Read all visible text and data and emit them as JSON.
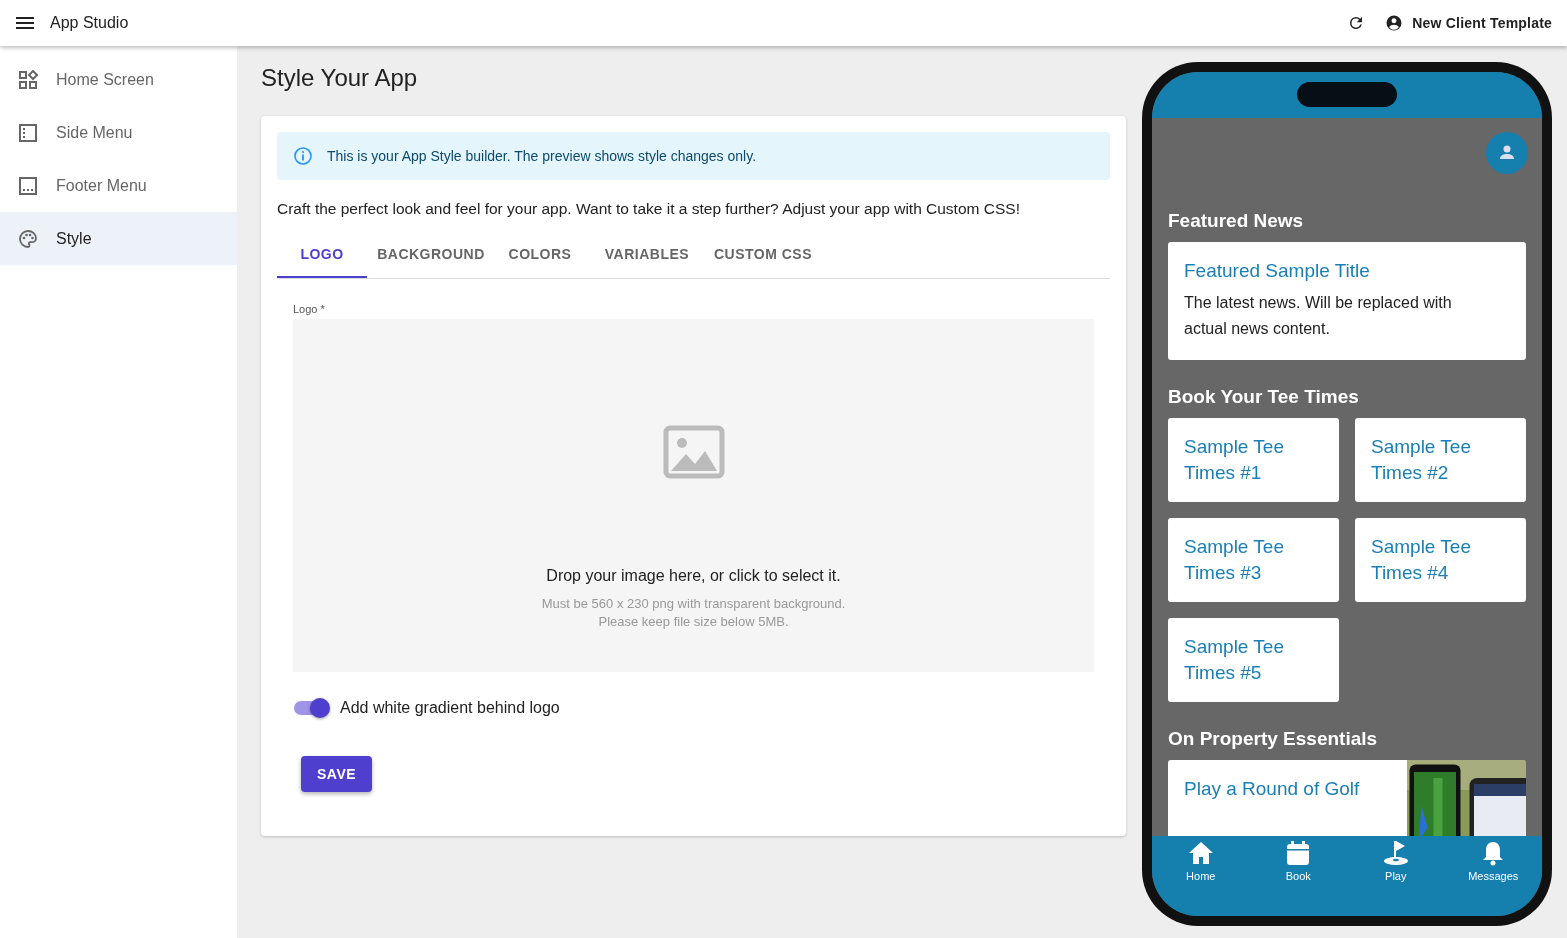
{
  "app_bar": {
    "title": "App Studio",
    "account": "New Client Template"
  },
  "sidebar": {
    "items": [
      {
        "label": "Home Screen",
        "kind": "home",
        "selected": false
      },
      {
        "label": "Side Menu",
        "kind": "side",
        "selected": false
      },
      {
        "label": "Footer Menu",
        "kind": "footer",
        "selected": false
      },
      {
        "label": "Style",
        "kind": "palette",
        "selected": true
      }
    ]
  },
  "page": {
    "title": "Style Your App",
    "info": "This is your App Style builder. The preview shows style changes only.",
    "intro": "Craft the perfect look and feel for your app. Want to take it a step further? Adjust your app with Custom CSS!",
    "tabs": [
      {
        "label": "LOGO",
        "selected": true
      },
      {
        "label": "BACKGROUND",
        "selected": false
      },
      {
        "label": "COLORS",
        "selected": false
      },
      {
        "label": "VARIABLES",
        "selected": false
      },
      {
        "label": "CUSTOM CSS",
        "selected": false
      }
    ],
    "logo_label": "Logo *",
    "drop_title": "Drop your image here, or click to select it.",
    "drop_hints": [
      "Must be 560 x 230 png with transparent background.",
      "Please keep file size below 5MB."
    ],
    "gradient_toggle": {
      "label": "Add white gradient behind logo",
      "on": true
    },
    "save": "SAVE"
  },
  "preview": {
    "featured": {
      "heading": "Featured News",
      "title": "Featured Sample Title",
      "body": "The latest news. Will be replaced with actual news content."
    },
    "tee": {
      "heading": "Book Your Tee Times",
      "items": [
        "Sample Tee Times #1",
        "Sample Tee Times #2",
        "Sample Tee Times #3",
        "Sample Tee Times #4",
        "Sample Tee Times #5"
      ]
    },
    "essentials": {
      "heading": "On Property Essentials",
      "title": "Play a Round of Golf"
    },
    "nav": [
      {
        "label": "Home",
        "kind": "home"
      },
      {
        "label": "Book",
        "kind": "book"
      },
      {
        "label": "Play",
        "kind": "play"
      },
      {
        "label": "Messages",
        "kind": "bell"
      }
    ]
  }
}
